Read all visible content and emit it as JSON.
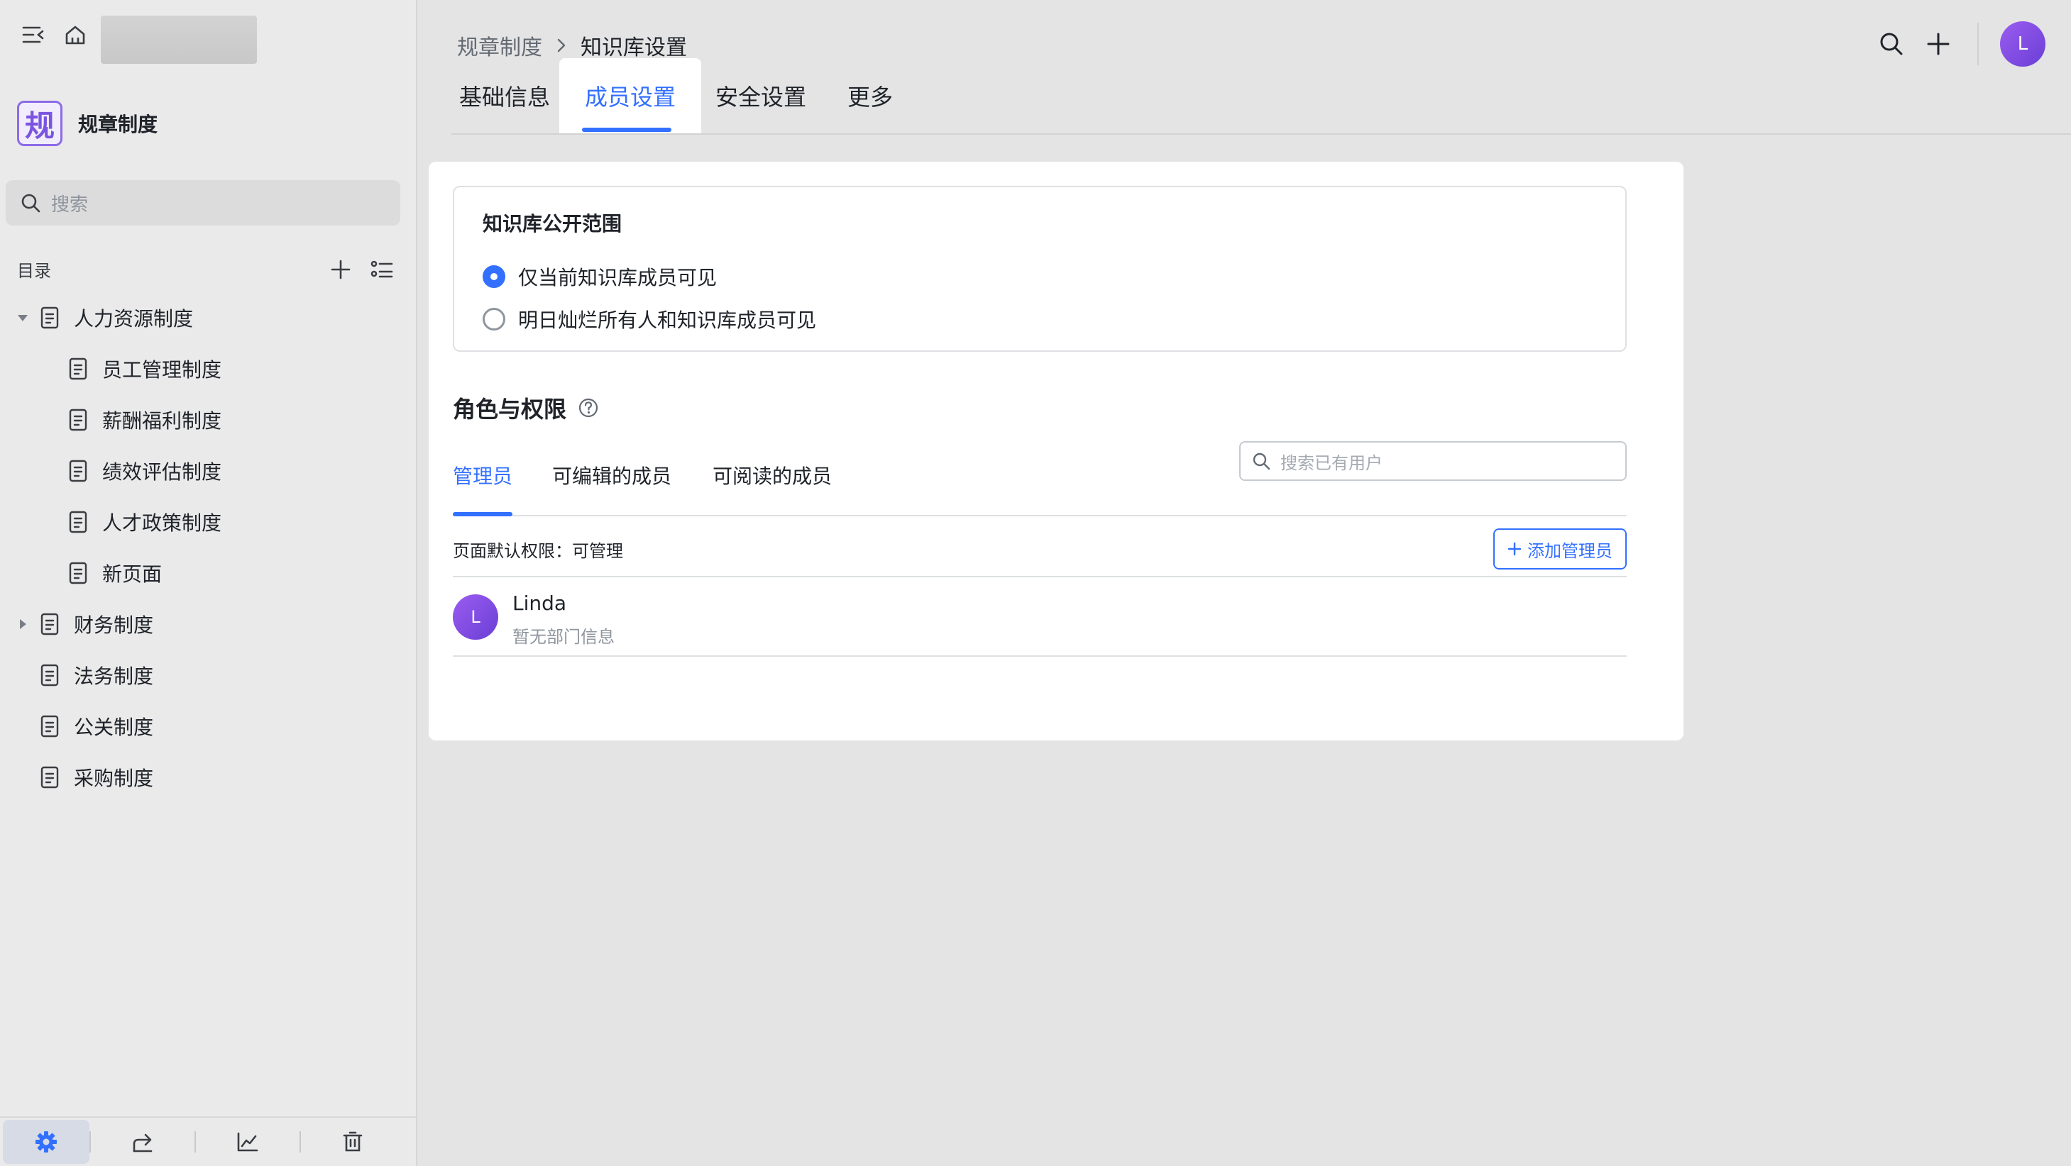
{
  "sidebar": {
    "space_avatar_char": "规",
    "space_name": "规章制度",
    "search_placeholder": "搜索",
    "toc_title": "目录",
    "tree": [
      {
        "label": "人力资源制度",
        "level": 0,
        "caret": "down"
      },
      {
        "label": "员工管理制度",
        "level": 1,
        "caret": ""
      },
      {
        "label": "薪酬福利制度",
        "level": 1,
        "caret": ""
      },
      {
        "label": "绩效评估制度",
        "level": 1,
        "caret": ""
      },
      {
        "label": "人才政策制度",
        "level": 1,
        "caret": ""
      },
      {
        "label": "新页面",
        "level": 1,
        "caret": ""
      },
      {
        "label": "财务制度",
        "level": 0,
        "caret": "right"
      },
      {
        "label": "法务制度",
        "level": 0,
        "caret": ""
      },
      {
        "label": "公关制度",
        "level": 0,
        "caret": ""
      },
      {
        "label": "采购制度",
        "level": 0,
        "caret": ""
      }
    ],
    "bottom_icons": [
      "settings-icon",
      "share-icon",
      "analytics-icon",
      "trash-icon"
    ]
  },
  "header": {
    "breadcrumb_parent": "规章制度",
    "breadcrumb_current": "知识库设置",
    "user_initial": "L"
  },
  "tabs": [
    {
      "label": "基础信息",
      "active": false
    },
    {
      "label": "成员设置",
      "active": true
    },
    {
      "label": "安全设置",
      "active": false
    },
    {
      "label": "更多",
      "active": false
    }
  ],
  "visibility": {
    "title": "知识库公开范围",
    "options": [
      {
        "label": "仅当前知识库成员可见",
        "selected": true
      },
      {
        "label": "明日灿烂所有人和知识库成员可见",
        "selected": false
      }
    ]
  },
  "roles": {
    "title": "角色与权限",
    "tabs": [
      {
        "label": "管理员",
        "active": true
      },
      {
        "label": "可编辑的成员",
        "active": false
      },
      {
        "label": "可阅读的成员",
        "active": false
      }
    ],
    "search_placeholder": "搜索已有用户",
    "default_permission": "页面默认权限：可管理",
    "add_button": "添加管理员",
    "members": [
      {
        "initial": "L",
        "name": "Linda",
        "dept": "暂无部门信息"
      }
    ]
  },
  "colors": {
    "accent": "#3370ff",
    "avatar": "#7b4fe3"
  }
}
